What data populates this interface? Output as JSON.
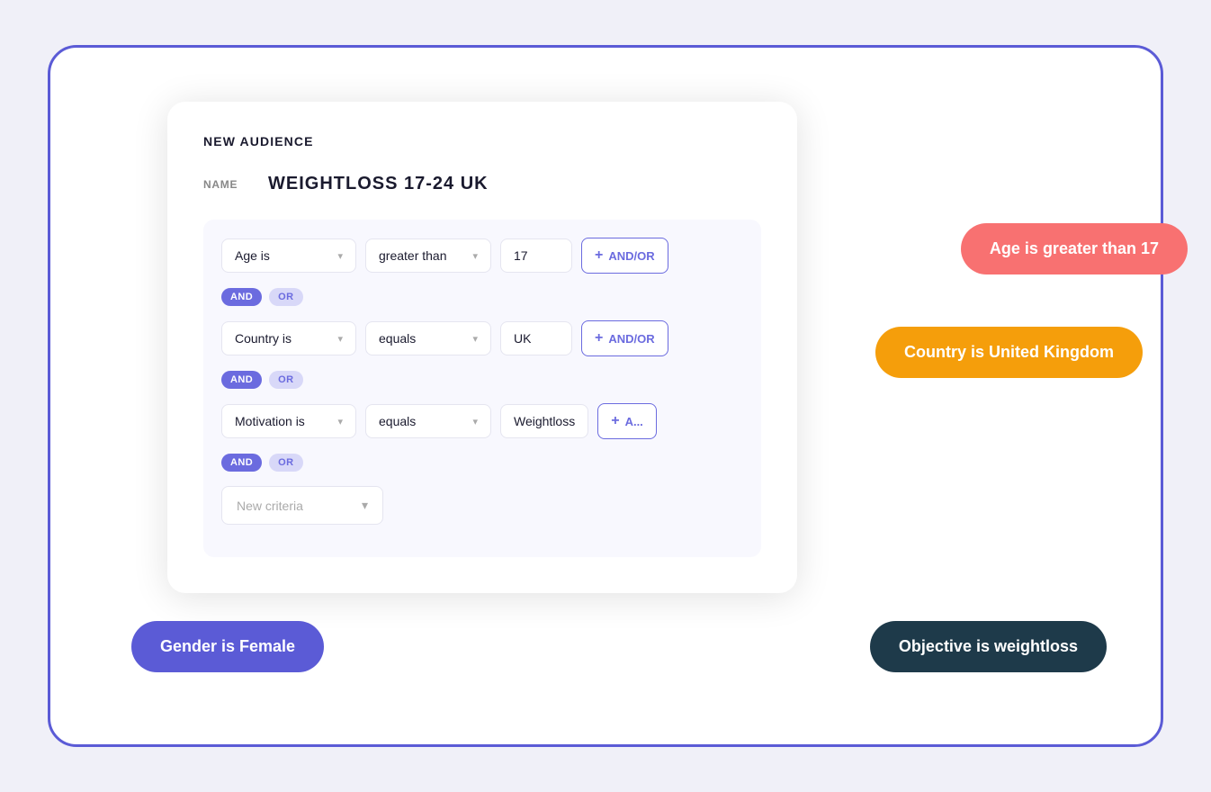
{
  "card": {
    "title": "NEW AUDIENCE",
    "name_label": "NAME",
    "name_value": "WEIGHTLOSS 17-24 UK"
  },
  "criteria": [
    {
      "field": "Age is",
      "operator": "greater than",
      "value": "17",
      "and_or_label": "+ AND/OR"
    },
    {
      "field": "Country is",
      "operator": "equals",
      "value": "UK",
      "and_or_label": "+ AND/OR"
    },
    {
      "field": "Motivation is",
      "operator": "equals",
      "value": "Weightloss",
      "and_or_label": "+ A..."
    }
  ],
  "connectors": [
    {
      "and": "AND",
      "or": "OR"
    },
    {
      "and": "AND",
      "or": "OR"
    },
    {
      "and": "AND",
      "or": "OR"
    }
  ],
  "new_criteria_placeholder": "New criteria",
  "badges": {
    "age": "Age is greater than 17",
    "country": "Country is United Kingdom",
    "gender": "Gender is Female",
    "objective": "Objective is weightloss"
  }
}
